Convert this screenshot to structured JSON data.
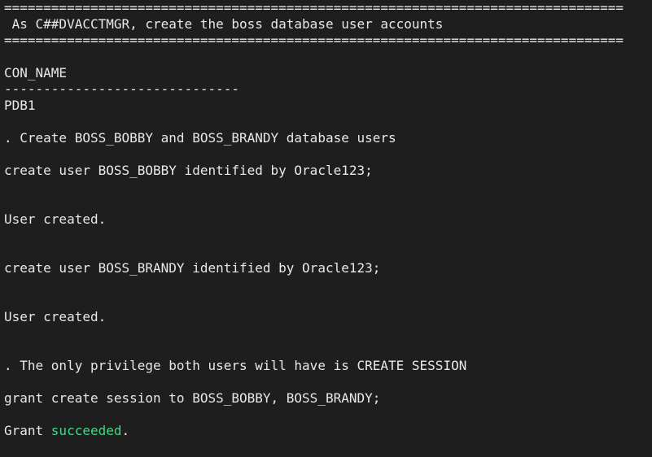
{
  "terminal": {
    "rule": "===============================================================================",
    "banner": " As C##DVACCTMGR, create the boss database user accounts",
    "con_name_header": "CON_NAME",
    "con_name_underline": "------------------------------",
    "con_name_value": "PDB1",
    "step1": ". Create BOSS_BOBBY and BOSS_BRANDY database users",
    "cmd1": "create user BOSS_BOBBY identified by Oracle123;",
    "result1": "User created.",
    "cmd2": "create user BOSS_BRANDY identified by Oracle123;",
    "result2": "User created.",
    "step2": ". The only privilege both users will have is CREATE SESSION",
    "cmd3": "grant create session to BOSS_BOBBY, BOSS_BRANDY;",
    "result3_prefix": "Grant ",
    "result3_word": "succeeded",
    "result3_suffix": ".",
    "success_color": "#3ddc84"
  }
}
